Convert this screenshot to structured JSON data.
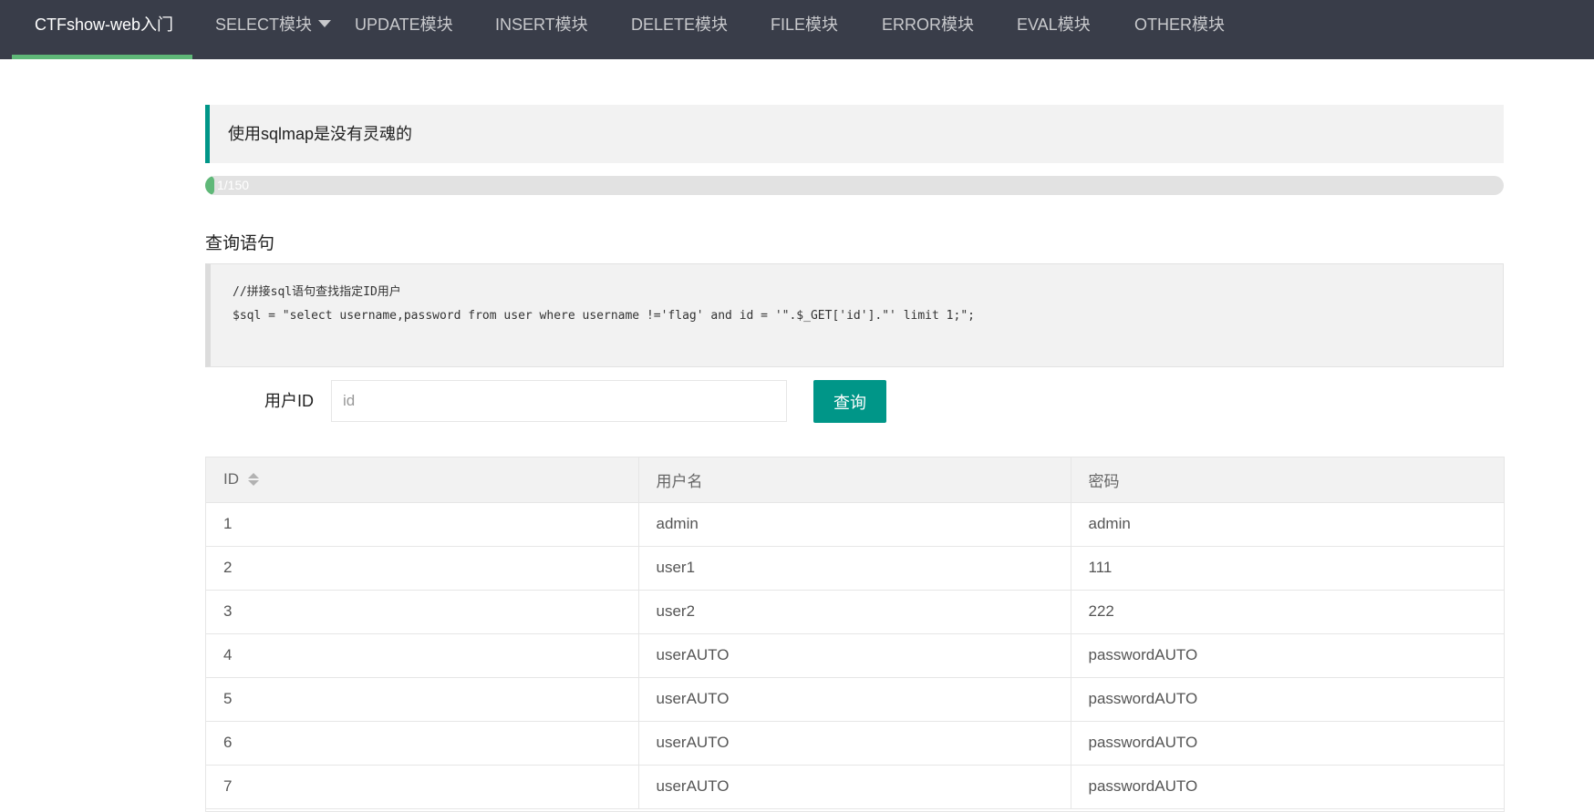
{
  "nav": {
    "items": [
      {
        "label": "CTFshow-web入门",
        "active": true
      },
      {
        "label": "SELECT模块",
        "dropdown": true
      },
      {
        "label": "UPDATE模块"
      },
      {
        "label": "INSERT模块"
      },
      {
        "label": "DELETE模块"
      },
      {
        "label": "FILE模块"
      },
      {
        "label": "ERROR模块"
      },
      {
        "label": "EVAL模块"
      },
      {
        "label": "OTHER模块"
      }
    ],
    "active_color": "#5fb878"
  },
  "notice": {
    "text": "使用sqlmap是没有灵魂的"
  },
  "progress": {
    "text": "1/150",
    "current": 1,
    "total": 150
  },
  "query_section": {
    "title": "查询语句",
    "code_lines": [
      "//拼接sql语句查找指定ID用户",
      "$sql = \"select username,password from user where username !='flag' and id = '\".$_GET['id'].\"' limit 1;\";"
    ]
  },
  "form": {
    "label": "用户ID",
    "placeholder": "id",
    "value": "",
    "button_label": "查询"
  },
  "table": {
    "columns": [
      "ID",
      "用户名",
      "密码"
    ],
    "rows": [
      [
        "1",
        "admin",
        "admin"
      ],
      [
        "2",
        "user1",
        "111"
      ],
      [
        "3",
        "user2",
        "222"
      ],
      [
        "4",
        "userAUTO",
        "passwordAUTO"
      ],
      [
        "5",
        "userAUTO",
        "passwordAUTO"
      ],
      [
        "6",
        "userAUTO",
        "passwordAUTO"
      ],
      [
        "7",
        "userAUTO",
        "passwordAUTO"
      ]
    ]
  },
  "colors": {
    "nav_bg": "#393d49",
    "accent": "#009688",
    "progress": "#5fb878"
  }
}
